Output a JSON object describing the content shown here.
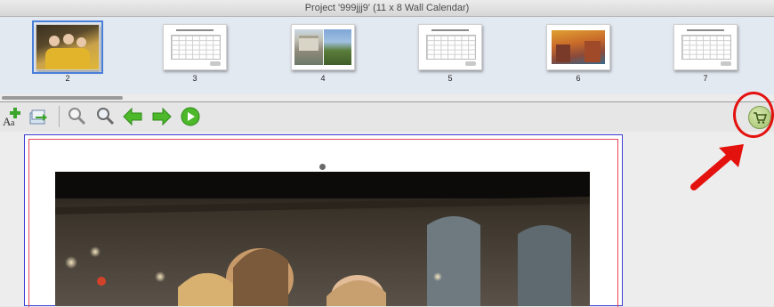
{
  "window": {
    "title": "Project '999jjj9' (11 x 8 Wall Calendar)"
  },
  "pages": [
    {
      "number": "2",
      "kind": "photo",
      "selected": true
    },
    {
      "number": "3",
      "kind": "calendar",
      "selected": false
    },
    {
      "number": "4",
      "kind": "photo",
      "selected": false
    },
    {
      "number": "5",
      "kind": "calendar",
      "selected": false
    },
    {
      "number": "6",
      "kind": "photo",
      "selected": false
    },
    {
      "number": "7",
      "kind": "calendar",
      "selected": false
    }
  ],
  "toolbar": {
    "buttons": [
      {
        "name": "add-text-icon"
      },
      {
        "name": "import-photos-icon"
      },
      {
        "name": "zoom-out-icon"
      },
      {
        "name": "zoom-in-icon"
      },
      {
        "name": "arrow-left-icon"
      },
      {
        "name": "arrow-right-icon"
      },
      {
        "name": "play-icon"
      },
      {
        "name": "shopping-cart-icon"
      }
    ]
  },
  "colors": {
    "accent_blue": "#4a7fd8",
    "green": "#4cb82a",
    "annotation_red": "#e4120f",
    "page_border_blue": "#3f3fd6",
    "page_border_red": "#e8475a"
  }
}
